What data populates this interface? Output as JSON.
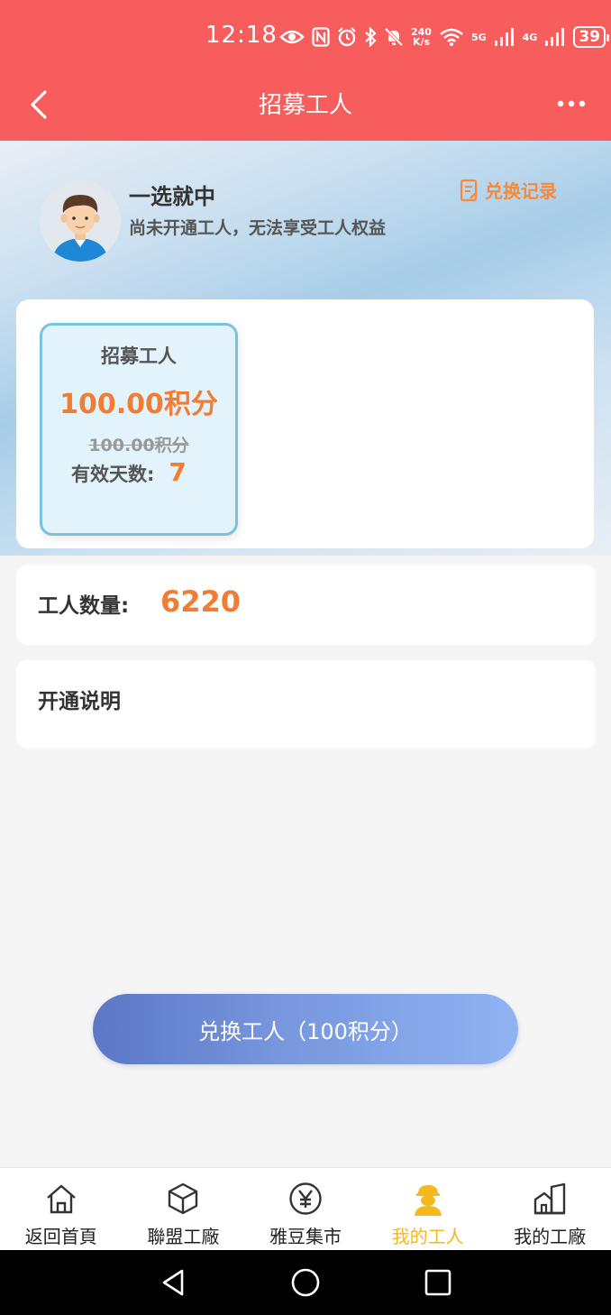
{
  "status_bar": {
    "time": "12:18",
    "net_speed_top": "240",
    "net_speed_bottom": "K/s",
    "net1": "5G",
    "net2": "4G",
    "battery": "39"
  },
  "header": {
    "title": "招募工人"
  },
  "user": {
    "name": "一选就中",
    "subtitle": "尚未开通工人，无法享受工人权益",
    "record_link": "兑换记录"
  },
  "plan": {
    "name": "招募工人",
    "price": "100.00积分",
    "original_price": "100.00积分",
    "days_label": "有效天数:",
    "days_value": "7"
  },
  "worker_count": {
    "label": "工人数量:",
    "value": "6220"
  },
  "description": {
    "title": "开通说明"
  },
  "exchange_button": {
    "label": "兑换工人（100积分）"
  },
  "tabs": [
    {
      "label": "返回首頁",
      "icon": "home-icon",
      "active": false
    },
    {
      "label": "聯盟工廠",
      "icon": "box-icon",
      "active": false
    },
    {
      "label": "雅豆集市",
      "icon": "yen-coin-icon",
      "active": false
    },
    {
      "label": "我的工人",
      "icon": "worker-icon",
      "active": true
    },
    {
      "label": "我的工廠",
      "icon": "factory-icon",
      "active": false
    }
  ],
  "colors": {
    "header_bg": "#f85d5d",
    "accent_orange": "#f07d35",
    "active_tab": "#f5b91d",
    "plan_border": "#79c3e1"
  }
}
